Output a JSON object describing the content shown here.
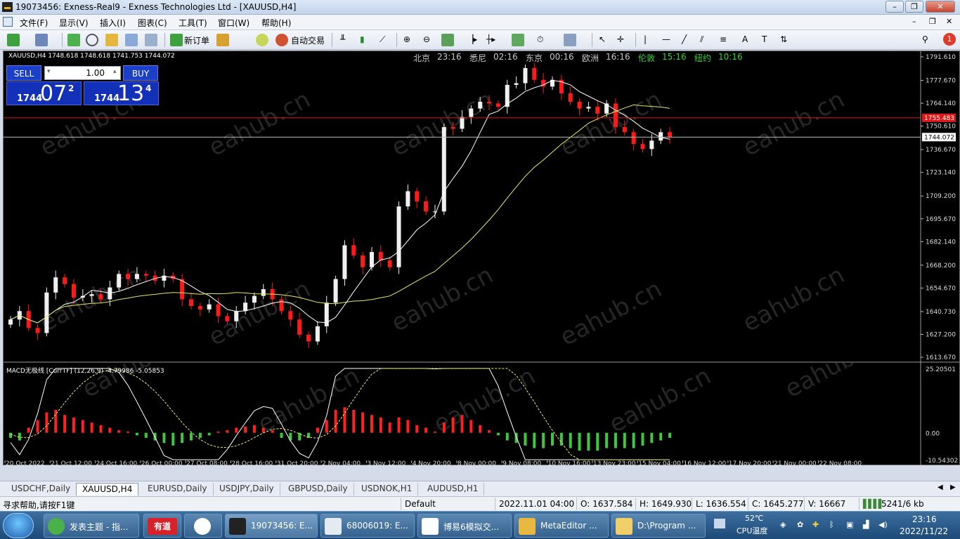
{
  "window": {
    "title": "19073456: Exness-Real9 - Exness Technologies Ltd - [XAUUSD,H4]",
    "controls": [
      "–",
      "❐",
      "✕"
    ]
  },
  "menu": [
    "文件(F)",
    "显示(V)",
    "插入(I)",
    "图表(C)",
    "工具(T)",
    "窗口(W)",
    "帮助(H)"
  ],
  "toolbar": {
    "new_order": "新订单",
    "auto_trade": "自动交易",
    "notification_count": "1"
  },
  "chart": {
    "symbol_line": "XAUUSD,H4  1748.618 1748.618 1741.753 1744.072",
    "clocks": [
      {
        "city": "北京",
        "time": "23:16",
        "color": "#c8c8c8"
      },
      {
        "city": "悉尼",
        "time": "02:16",
        "color": "#c8c8c8"
      },
      {
        "city": "东京",
        "time": "00:16",
        "color": "#c8c8c8"
      },
      {
        "city": "欧洲",
        "time": "16:16",
        "color": "#c8c8c8"
      },
      {
        "city": "伦敦",
        "time": "15:16",
        "color": "#2fd42f"
      },
      {
        "city": "纽约",
        "time": "10:16",
        "color": "#2fd42f"
      }
    ],
    "trade_panel": {
      "sell_label": "SELL",
      "buy_label": "BUY",
      "lot": "1.00",
      "sell_small": "1744",
      "sell_big": "07",
      "sell_sup": "2",
      "buy_small": "1744",
      "buy_big": "13",
      "buy_sup": "4"
    },
    "price_axis": [
      "1791.610",
      "1777.670",
      "1764.140",
      "1750.610",
      "1736.670",
      "1723.140",
      "1709.200",
      "1695.670",
      "1682.140",
      "1668.200",
      "1654.670",
      "1640.730",
      "1627.200",
      "1613.670"
    ],
    "red_line_label": "1755.483",
    "current_price_label": "1744.072",
    "time_axis": [
      "20 Oct 2022",
      "21 Oct 12:00",
      "24 Oct 16:00",
      "26 Oct 00:00",
      "27 Oct 08:00",
      "28 Oct 16:00",
      "31 Oct 20:00",
      "2 Nov 04:00",
      "3 Nov 12:00",
      "4 Nov 20:00",
      "8 Nov 00:00",
      "9 Nov 08:00",
      "10 Nov 16:00",
      "13 Nov 23:00",
      "15 Nov 04:00",
      "16 Nov 12:00",
      "17 Nov 20:00",
      "21 Nov 00:00",
      "22 Nov 08:00"
    ],
    "watermark": "eahub.cn",
    "colors": {
      "bull": "#f0f0f0",
      "bear": "#ff1a1a",
      "ma_fast": "#ffffff",
      "ma_slow": "#e8e85a",
      "macd_up": "#ff2020",
      "macd_down": "#3ec83e"
    }
  },
  "macd": {
    "label": "MACD无极线 [CurrTF] (12,26,9) -4.79986 -5.05853",
    "axis": [
      "25.20501",
      "0.00",
      "-10.54302"
    ]
  },
  "chart_data": {
    "type": "candlestick",
    "symbol": "XAUUSD",
    "timeframe": "H4",
    "ylim": [
      1613.67,
      1791.61
    ],
    "closes": [
      1636,
      1641,
      1631,
      1628,
      1652,
      1661,
      1657,
      1649,
      1650,
      1651,
      1648,
      1655,
      1663,
      1660,
      1663,
      1662,
      1659,
      1662,
      1660,
      1648,
      1644,
      1642,
      1645,
      1638,
      1635,
      1641,
      1646,
      1650,
      1654,
      1648,
      1641,
      1636,
      1627,
      1623,
      1632,
      1646,
      1660,
      1680,
      1674,
      1667,
      1676,
      1671,
      1667,
      1703,
      1712,
      1706,
      1700,
      1700,
      1750,
      1749,
      1756,
      1761,
      1765,
      1764,
      1762,
      1775,
      1776,
      1785,
      1778,
      1774,
      1778,
      1770,
      1765,
      1761,
      1762,
      1758,
      1764,
      1750,
      1747,
      1740,
      1737,
      1742,
      1747,
      1744
    ],
    "red_line": 1755.483,
    "current": 1744.072,
    "macd_ylim": [
      -10.54302,
      25.20501
    ],
    "macd_histogram": [
      -2,
      -3,
      2,
      5,
      8,
      9,
      7,
      6,
      5,
      4,
      3,
      2,
      1,
      0.5,
      -1,
      -2,
      -3,
      -4,
      -5,
      -4,
      -3,
      -2,
      -1,
      0.5,
      1,
      2,
      2.5,
      3,
      2,
      1,
      -2,
      -3,
      -3,
      -2,
      2,
      5,
      9,
      10,
      9,
      8,
      7,
      6,
      4,
      6,
      5,
      3,
      2,
      0.5,
      4,
      6,
      7,
      5,
      3,
      1,
      -1,
      -3,
      -4,
      -5,
      -6,
      -6,
      -5,
      -5,
      -6,
      -7,
      -7,
      -7,
      -6,
      -6,
      -6,
      -6,
      -5,
      -4,
      -3,
      -2
    ]
  },
  "tabs": [
    "USDCHF,Daily",
    "XAUUSD,H4",
    "EURUSD,Daily",
    "USDJPY,Daily",
    "GBPUSD,Daily",
    "USDNOK,H1",
    "AUDUSD,H1"
  ],
  "active_tab": "XAUUSD,H4",
  "status": {
    "help": "寻求帮助,请按F1键",
    "profile": "Default",
    "time": "2022.11.01 04:00",
    "open": "O: 1637.584",
    "high": "H: 1649.930",
    "low": "L: 1636.554",
    "close": "C: 1645.277",
    "volume": "V: 16667",
    "traffic": "5241/6 kb"
  },
  "taskbar": {
    "items": [
      "发表主题 - 指...",
      "有道",
      "",
      "19073456: E...",
      "68006019: E...",
      "博易6模拟交...",
      "MetaEditor ...",
      "D:\\Program ..."
    ],
    "temp": "52℃",
    "temp_label": "CPU温度",
    "clock_time": "23:16",
    "clock_date": "2022/11/22"
  }
}
